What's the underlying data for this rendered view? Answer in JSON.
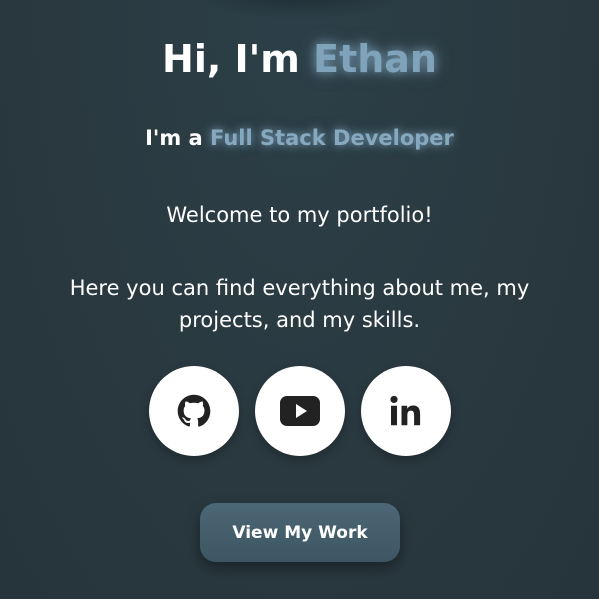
{
  "hero": {
    "greeting_prefix": "Hi, I'm ",
    "name": "Ethan",
    "role_prefix": "I'm a ",
    "role": "Full Stack Developer",
    "welcome": "Welcome to my portfolio!",
    "description": "Here you can find everything about me, my projects, and my skills."
  },
  "socials": [
    {
      "name": "GitHub",
      "icon": "github-icon"
    },
    {
      "name": "YouTube",
      "icon": "youtube-icon"
    },
    {
      "name": "LinkedIn",
      "icon": "linkedin-icon"
    }
  ],
  "cta": {
    "label": "View My Work"
  },
  "colors": {
    "background": "#2b3a42",
    "accent": "#7fa3bb",
    "button": "#465f6d",
    "icon_circle": "#ffffff",
    "icon": "#222222"
  }
}
